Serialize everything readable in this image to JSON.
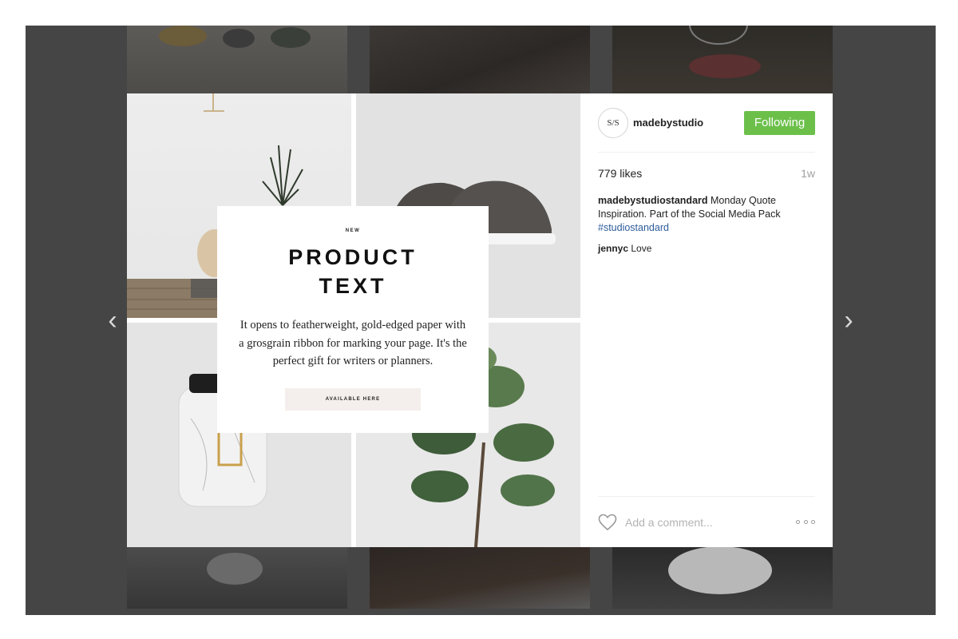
{
  "post": {
    "username": "madebystudio",
    "avatar_text": "S/S",
    "follow_label": "Following",
    "likes": "779 likes",
    "time": "1w",
    "caption_user": "madebystudiostandard",
    "caption_text": "Monday Quote Inspiration. Part of the Social Media Pack",
    "hashtag": "#studiostandard",
    "comment_user": "jennyc",
    "comment_text": "Love",
    "comment_placeholder": "Add a comment...",
    "icons": [
      "heart-icon",
      "more-icon",
      "chevron-left-icon",
      "chevron-right-icon"
    ],
    "accent_color": "#6cc04a"
  },
  "card": {
    "eyebrow": "NEW",
    "title_line1": "PRODUCT",
    "title_line2": "TEXT",
    "body": "It opens to featherweight, gold-edged paper with a grosgrain ribbon for marking your page. It's the perfect gift for writers or planners.",
    "cta": "AVAILABLE HERE"
  },
  "nav": {
    "prev": "‹",
    "next": "›"
  }
}
